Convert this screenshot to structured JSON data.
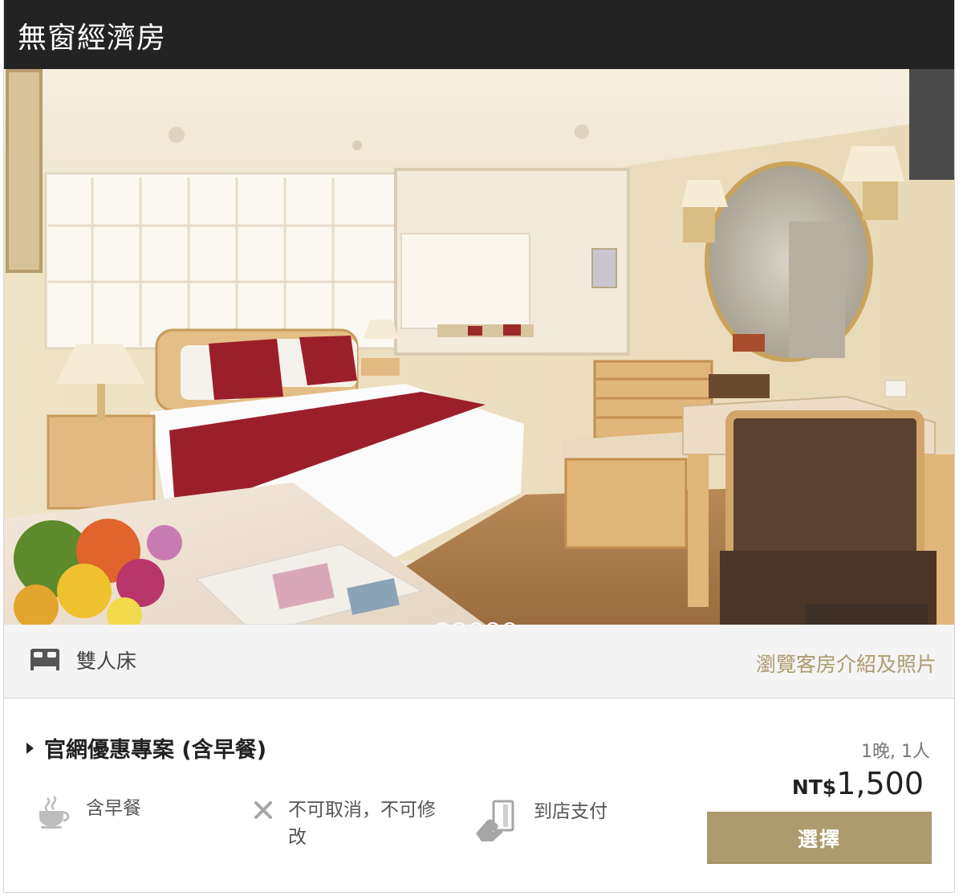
{
  "room": {
    "title": "無窗經濟房",
    "bed_type": "雙人床",
    "browse_link": "瀏覽客房介紹及照片"
  },
  "carousel": {
    "slide_count": 5,
    "active_index": 0,
    "prev_glyph": "‹",
    "next_glyph": "›"
  },
  "rate": {
    "title": "官網優惠專案 (含早餐)",
    "stay": "1晚, 1人",
    "currency": "NT$",
    "amount": "1,500",
    "select_label": "選擇",
    "features": [
      {
        "icon": "coffee-cup-icon",
        "label": "含早餐"
      },
      {
        "icon": "cross-icon",
        "label": "不可取消，不可修改"
      },
      {
        "icon": "hand-card-icon",
        "label": "到店支付"
      }
    ]
  },
  "colors": {
    "header_bg": "#232323",
    "accent": "#ad9b6d",
    "bar_bg": "#f4f4f4"
  }
}
